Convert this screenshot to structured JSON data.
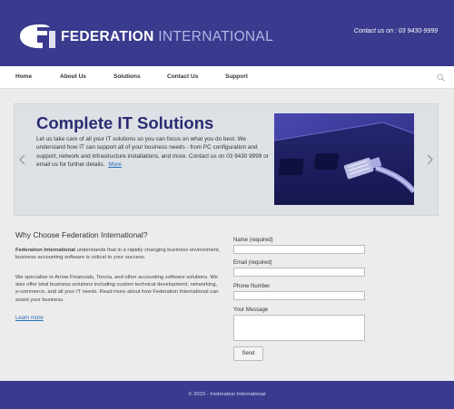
{
  "header": {
    "logo_strong": "FEDERATION",
    "logo_light": "INTERNATIONAL",
    "contact": "Contact us on : 03 9430-9999",
    "background_color": "#3a3a8e"
  },
  "nav": {
    "items": [
      "Home",
      "About Us",
      "Solutions",
      "Contact Us",
      "Support"
    ],
    "search_icon": "search-icon"
  },
  "slider": {
    "title": "Complete IT Solutions",
    "text": "Let us take care of all your IT solutions so you can focus on what you do best. We understand how IT can support all of your business needs - from PC configuration and support, network and infrastructure installations, and more. Contact us on 03 9430 9999 or email us for further details.",
    "more_link": "More",
    "prev_icon": "chevron-left-icon",
    "next_icon": "chevron-right-icon"
  },
  "why": {
    "title": "Why Choose Federation International?",
    "para1_bold": "Federation International",
    "para1_rest": " understands that in a rapidly changing business environment, business accounting software is critical to your success.",
    "para2": "We specialise in Arrow Financials, Tencia, and other accounting software solutions. We also offer total business solutions including custom technical development, networking, e-commerce, and all your IT needs. Read more about how Federation International can assist your business.",
    "learn_more": "Learn more"
  },
  "form": {
    "name_label": "Name (required)",
    "email_label": "Email (required)",
    "phone_label": "Phone Number",
    "message_label": "Your Message",
    "send_label": "Send"
  },
  "footer": {
    "text": "© 2015 - Federation International"
  }
}
